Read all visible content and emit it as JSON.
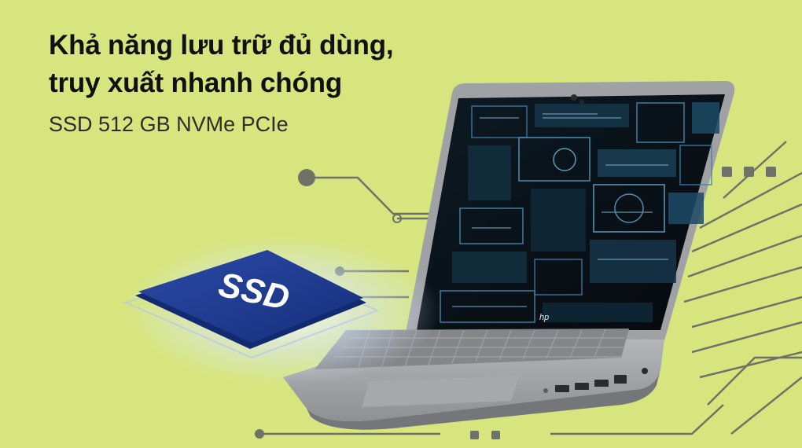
{
  "banner": {
    "headline_line1": "Khả năng lưu trữ đủ dùng,",
    "headline_line2": "truy xuất nhanh chóng",
    "subline": "SSD 512 GB NVMe PCIe"
  },
  "ssd_chip": {
    "label": "SSD"
  },
  "laptop": {
    "brand_logo": "hp"
  },
  "colors": {
    "background": "#d7e57e",
    "circuit": "#6f7266",
    "chip": "#1f3b8f",
    "laptop_body": "#9b9da0"
  }
}
